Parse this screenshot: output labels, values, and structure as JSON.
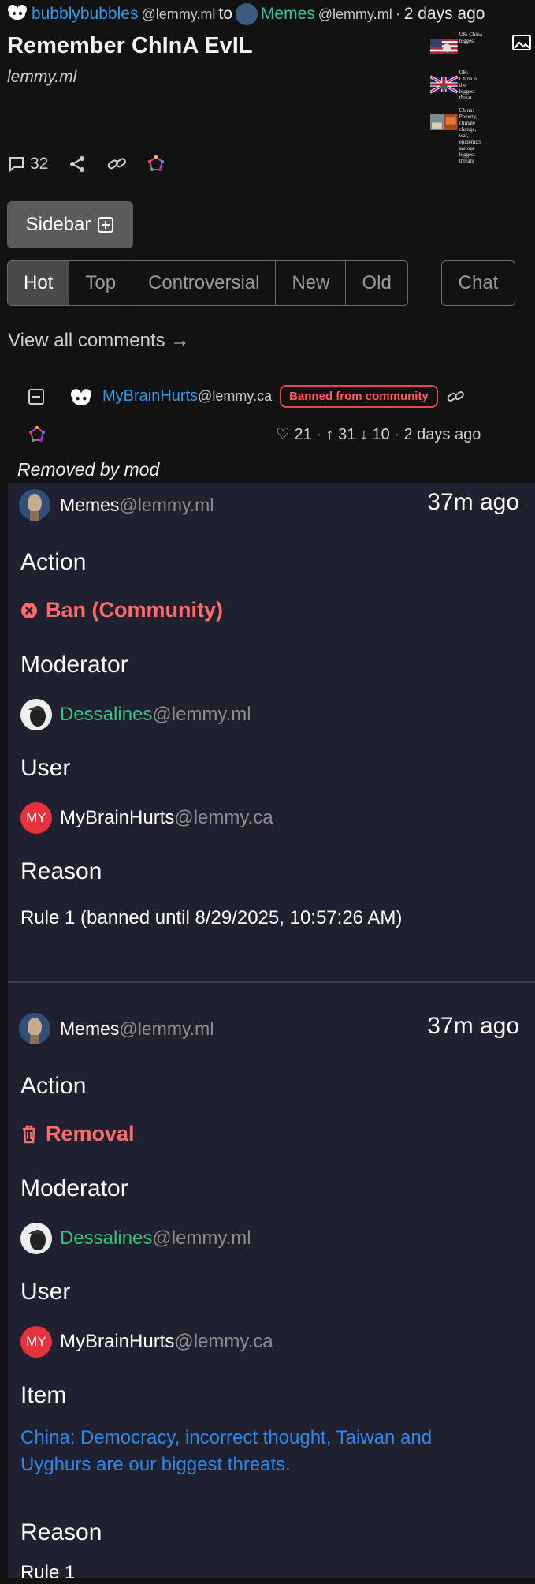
{
  "post": {
    "creator_name": "bubblybubbles",
    "creator_instance": "@lemmy.ml",
    "to_word": "to",
    "community_name": "Memes",
    "community_instance": "@lemmy.ml",
    "separator": "·",
    "posted_ago": "2 days ago",
    "title": "Remember ChInA EvIL",
    "domain": "lemmy.ml",
    "comment_count": "32",
    "thumb_captions": [
      "US: China biggest",
      "UK: China is the biggest threat.",
      "China: Poverty, climate change, war, epidemics are our biggest threats"
    ]
  },
  "controls": {
    "sidebar_label": "Sidebar",
    "sort_options": [
      "Hot",
      "Top",
      "Controversial",
      "New",
      "Old"
    ],
    "chat_label": "Chat",
    "view_all_comments": "View all comments →"
  },
  "comment": {
    "author_name": "MyBrainHurts",
    "author_instance": "@lemmy.ca",
    "badge": "Banned from community",
    "likes": "21",
    "upvotes": "31",
    "downvotes": "10",
    "posted_ago": "2 days ago",
    "status": "Removed by mod"
  },
  "modlog": [
    {
      "community_name": "Memes",
      "community_instance": "@lemmy.ml",
      "time": "37m ago",
      "action_label": "Action",
      "action": "Ban (Community)",
      "moderator_label": "Moderator",
      "moderator_name": "Dessalines",
      "moderator_instance": "@lemmy.ml",
      "user_label": "User",
      "user_avatar": "MY",
      "user_name": "MyBrainHurts",
      "user_instance": "@lemmy.ca",
      "reason_label": "Reason",
      "reason": "Rule 1 (banned until 8/29/2025, 10:57:26 AM)"
    },
    {
      "community_name": "Memes",
      "community_instance": "@lemmy.ml",
      "time": "37m ago",
      "action_label": "Action",
      "action": "Removal",
      "moderator_label": "Moderator",
      "moderator_name": "Dessalines",
      "moderator_instance": "@lemmy.ml",
      "user_label": "User",
      "user_avatar": "MY",
      "user_name": "MyBrainHurts",
      "user_instance": "@lemmy.ca",
      "item_label": "Item",
      "item": "China: Democracy, incorrect thought, Taiwan and Uyghurs are our biggest threats.",
      "reason_label": "Reason",
      "reason": "Rule 1"
    }
  ],
  "colors": {
    "accent_blue": "#2f9be9",
    "community_teal": "#2fc6a7",
    "danger_red": "#ff6b6b",
    "moderator_green": "#3ac07b",
    "panel_bg": "#1f2130"
  }
}
